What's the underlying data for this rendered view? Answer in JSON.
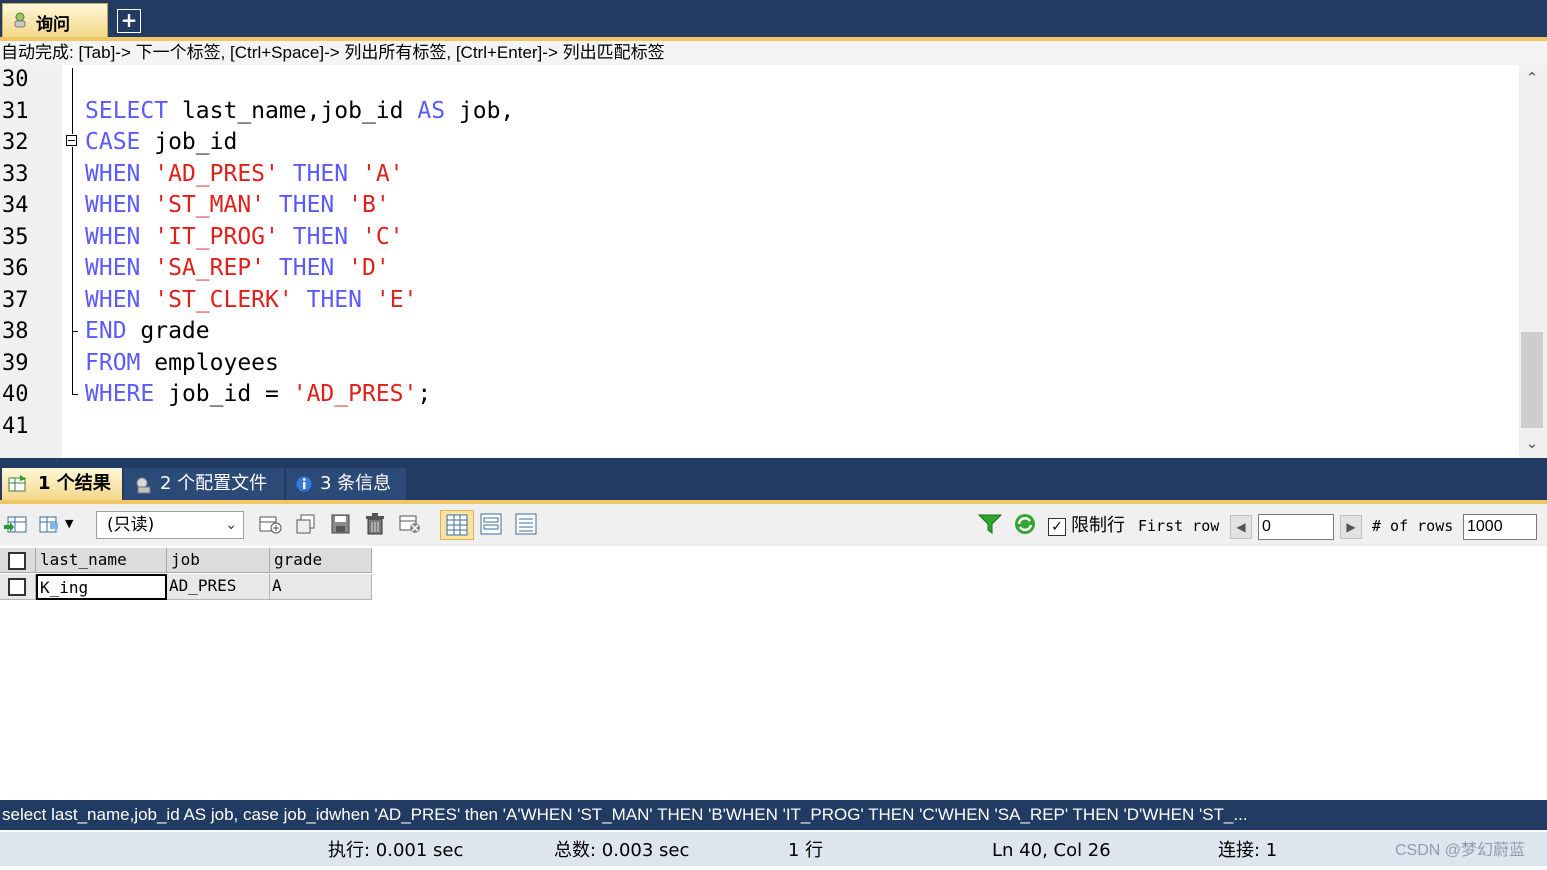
{
  "tabs": {
    "query_label": "询问",
    "add_label": "+"
  },
  "hint": "自动完成:  [Tab]-> 下一个标签,  [Ctrl+Space]-> 列出所有标签,  [Ctrl+Enter]-> 列出匹配标签",
  "editor": {
    "lines": [
      {
        "n": "30",
        "tokens": []
      },
      {
        "n": "31",
        "tokens": [
          {
            "t": "SELECT",
            "c": "kw"
          },
          {
            "t": " last_name,job_id ",
            "c": ""
          },
          {
            "t": "AS",
            "c": "kw"
          },
          {
            "t": " job,",
            "c": ""
          }
        ]
      },
      {
        "n": "32",
        "tokens": [
          {
            "t": "CASE",
            "c": "kw"
          },
          {
            "t": " job_id",
            "c": ""
          }
        ]
      },
      {
        "n": "33",
        "tokens": [
          {
            "t": "WHEN",
            "c": "kw"
          },
          {
            "t": " ",
            "c": ""
          },
          {
            "t": "'AD_PRES'",
            "c": "str"
          },
          {
            "t": " ",
            "c": ""
          },
          {
            "t": "THEN",
            "c": "kw"
          },
          {
            "t": " ",
            "c": ""
          },
          {
            "t": "'A'",
            "c": "str"
          }
        ]
      },
      {
        "n": "34",
        "tokens": [
          {
            "t": "WHEN",
            "c": "kw"
          },
          {
            "t": " ",
            "c": ""
          },
          {
            "t": "'ST_MAN'",
            "c": "str"
          },
          {
            "t": " ",
            "c": ""
          },
          {
            "t": "THEN",
            "c": "kw"
          },
          {
            "t": " ",
            "c": ""
          },
          {
            "t": "'B'",
            "c": "str"
          }
        ]
      },
      {
        "n": "35",
        "tokens": [
          {
            "t": "WHEN",
            "c": "kw"
          },
          {
            "t": " ",
            "c": ""
          },
          {
            "t": "'IT_PROG'",
            "c": "str"
          },
          {
            "t": " ",
            "c": ""
          },
          {
            "t": "THEN",
            "c": "kw"
          },
          {
            "t": " ",
            "c": ""
          },
          {
            "t": "'C'",
            "c": "str"
          }
        ]
      },
      {
        "n": "36",
        "tokens": [
          {
            "t": "WHEN",
            "c": "kw"
          },
          {
            "t": " ",
            "c": ""
          },
          {
            "t": "'SA_REP'",
            "c": "str"
          },
          {
            "t": " ",
            "c": ""
          },
          {
            "t": "THEN",
            "c": "kw"
          },
          {
            "t": " ",
            "c": ""
          },
          {
            "t": "'D'",
            "c": "str"
          }
        ]
      },
      {
        "n": "37",
        "tokens": [
          {
            "t": "WHEN",
            "c": "kw"
          },
          {
            "t": " ",
            "c": ""
          },
          {
            "t": "'ST_CLERK'",
            "c": "str"
          },
          {
            "t": " ",
            "c": ""
          },
          {
            "t": "THEN",
            "c": "kw"
          },
          {
            "t": " ",
            "c": ""
          },
          {
            "t": "'E'",
            "c": "str"
          }
        ]
      },
      {
        "n": "38",
        "tokens": [
          {
            "t": "END",
            "c": "kw"
          },
          {
            "t": " grade",
            "c": ""
          }
        ]
      },
      {
        "n": "39",
        "tokens": [
          {
            "t": "FROM",
            "c": "kw"
          },
          {
            "t": " employees",
            "c": ""
          }
        ]
      },
      {
        "n": "40",
        "tokens": [
          {
            "t": "WHERE",
            "c": "kw"
          },
          {
            "t": " job_id = ",
            "c": ""
          },
          {
            "t": "'AD_PRES'",
            "c": "str"
          },
          {
            "t": ";",
            "c": ""
          }
        ]
      },
      {
        "n": "41",
        "tokens": []
      }
    ]
  },
  "result_tabs": {
    "results": "1 个结果",
    "profile": "2 个配置文件",
    "messages": "3 条信息"
  },
  "toolbar": {
    "readonly_value": "(只读)",
    "limit_rows_label": "限制行",
    "first_row_label": "First row",
    "first_row_value": "0",
    "num_rows_label": "# of rows",
    "num_rows_value": "1000"
  },
  "grid": {
    "columns": [
      "last_name",
      "job",
      "grade"
    ],
    "rows": [
      [
        "K_ing",
        "AD_PRES",
        "A"
      ]
    ]
  },
  "sql_status": "select last_name,job_id AS job, case job_idwhen 'AD_PRES' then 'A'WHEN 'ST_MAN' THEN 'B'WHEN 'IT_PROG' THEN 'C'WHEN 'SA_REP' THEN 'D'WHEN 'ST_...",
  "status": {
    "exec": "执行: 0.001 sec",
    "total": "总数: 0.003 sec",
    "rows": "1 行",
    "position": "Ln 40, Col 26",
    "connection": "连接: 1"
  },
  "watermark": "CSDN @梦幻蔚蓝",
  "colors": {
    "keyword": "#5a5aff",
    "string": "#e0201b",
    "chrome": "#223b63",
    "accent": "#f1c766"
  }
}
